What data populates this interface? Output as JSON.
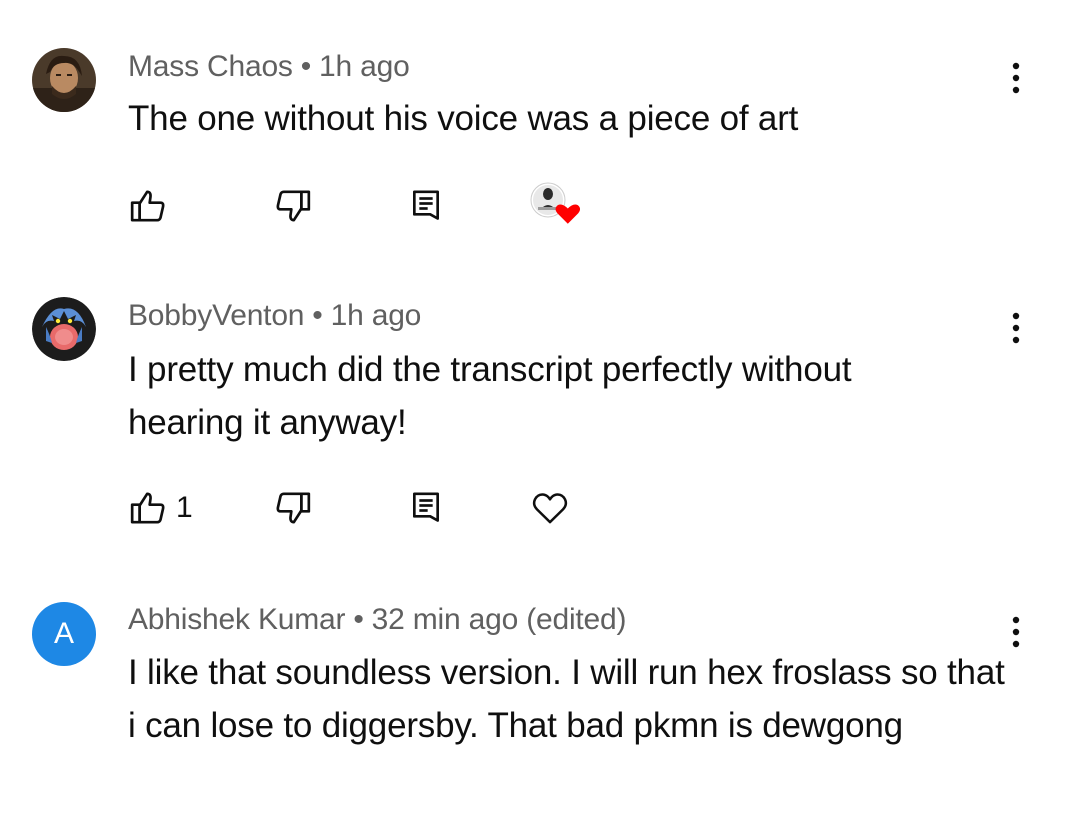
{
  "comments": [
    {
      "author": "Mass Chaos",
      "separator": "•",
      "time": "1h ago",
      "text": "The one without his voice was a piece of art",
      "like_count": "",
      "creator_heart": true
    },
    {
      "author": "BobbyVenton",
      "separator": "•",
      "time": "1h ago",
      "text": "I pretty much did the transcript perfectly without hearing it anyway!",
      "like_count": "1",
      "creator_heart": false
    },
    {
      "author": "Abhishek Kumar",
      "separator": "•",
      "time": "32 min ago (edited)",
      "text": "I like that soundless version. I will run hex froslass so that i can lose to diggersby. That bad pkmn is dewgong",
      "avatar_letter": "A",
      "avatar_color": "#1e88e5"
    }
  ],
  "icons": {
    "like": "thumbs-up-icon",
    "dislike": "thumbs-down-icon",
    "reply": "reply-icon",
    "heart": "heart-icon",
    "more": "more-vert-icon"
  },
  "colors": {
    "meta_text": "#606060",
    "body_text": "#0f0f0f",
    "heart_red": "#ff0000",
    "avatar_blue": "#1e88e5"
  }
}
